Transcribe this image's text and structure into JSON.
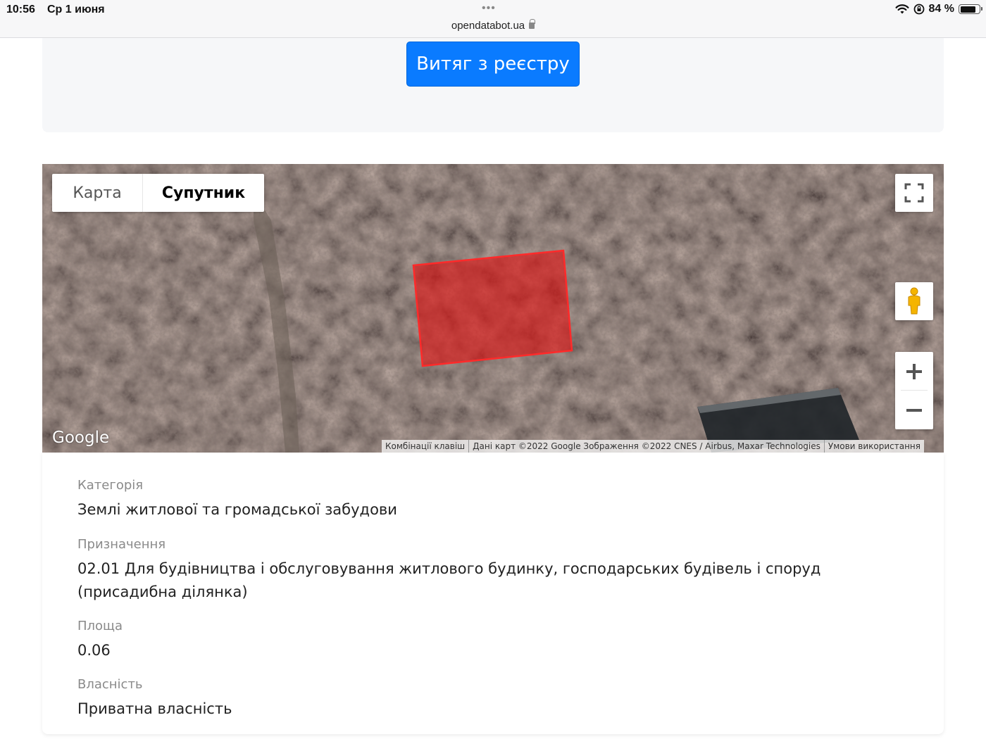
{
  "status_bar": {
    "time": "10:56",
    "date": "Ср 1 июня",
    "battery": "84 %",
    "battery_level": 0.84
  },
  "browser": {
    "url": "opendatabot.ua"
  },
  "registry_button_label": "Витяг з реєстру",
  "map": {
    "tabs": {
      "map": "Карта",
      "satellite": "Супутник",
      "active": "satellite"
    },
    "logo": "Google",
    "attribution": {
      "shortcuts": "Комбінації клавіш",
      "data": "Дані карт ©2022 Google Зображення ©2022 CNES / Airbus, Maxar Technologies",
      "terms": "Умови використання"
    },
    "parcel_color": "#e01010"
  },
  "details": {
    "category": {
      "label": "Категорія",
      "value": "Землі житлової та громадської забудови"
    },
    "purpose": {
      "label": "Призначення",
      "value": "02.01 Для будівництва і обслуговування житлового будинку, господарських будівель і споруд (присадибна ділянка)"
    },
    "area": {
      "label": "Площа",
      "value": "0.06"
    },
    "ownership": {
      "label": "Власність",
      "value": "Приватна власність"
    }
  }
}
